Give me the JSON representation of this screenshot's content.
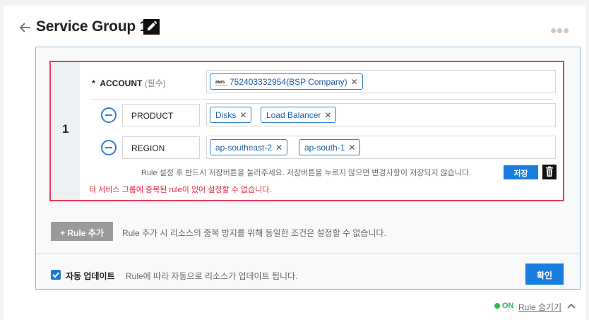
{
  "header": {
    "title": "Service Group 1",
    "back_icon": "back-arrow-icon",
    "edit_icon": "pencil-icon",
    "more_icon": "more-horizontal-icon"
  },
  "rule": {
    "index": "1",
    "account": {
      "label": "ACCOUNT",
      "required_prefix": "*",
      "required_note": "(필수)",
      "tags": [
        {
          "provider_icon": "aws",
          "label": "752403332954(BSP Company)"
        }
      ]
    },
    "conditions": [
      {
        "key": "PRODUCT",
        "tags": [
          "Disks",
          "Load Balancer"
        ]
      },
      {
        "key": "REGION",
        "tags": [
          "ap-southeast-2",
          "ap-south-1"
        ]
      }
    ],
    "save_hint": "Rule 설정 후 반드시 저장버튼을 눌러주세요. 저장버튼을 누르지 않으면 변경사항이 저장되지 않습니다.",
    "save_label": "저장",
    "error_message": "타 서비스 그룹에 중복된 rule이 있어 설정할 수 없습니다."
  },
  "add_rule": {
    "label": "+ Rule 추가",
    "hint": "Rule 추가 시 리소스의 중복 방지를 위해 동일한 조건은 설정할 수 없습니다."
  },
  "auto_update": {
    "checked": true,
    "label": "자동 업데이트",
    "description": "Rule에 따라 자동으로 리소스가 업데이트 됩니다."
  },
  "confirm_label": "확인",
  "footer": {
    "status": "ON",
    "hide_link": "Rule 숨기기"
  },
  "colors": {
    "accent": "#1a7ee0",
    "error_border": "#e63b5a",
    "status_on": "#2db84a"
  }
}
